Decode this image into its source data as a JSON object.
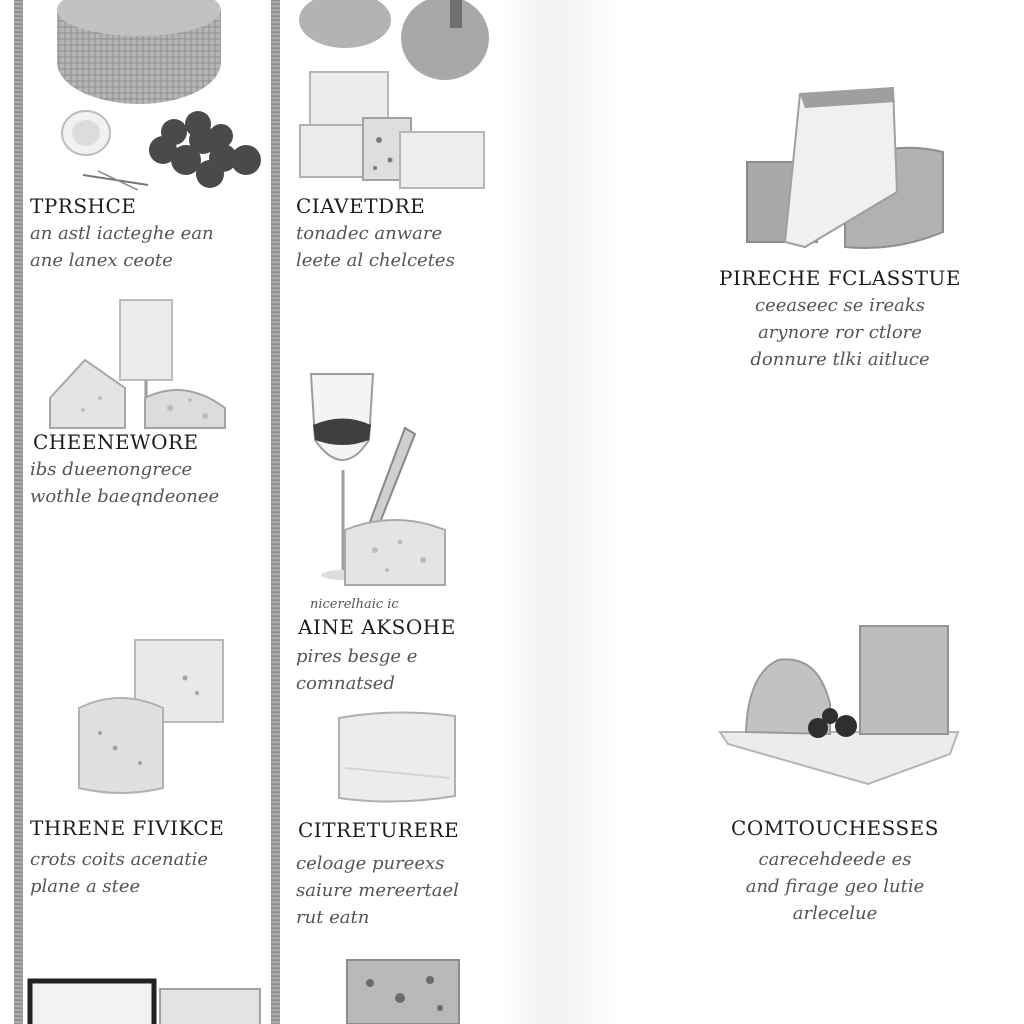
{
  "cards": [
    {
      "title": "TPRSHCE",
      "lines": [
        "an astl iacteghe ean",
        "ane lanex ceote"
      ]
    },
    {
      "title": "CIAVETDRE",
      "lines": [
        "tonadec anware",
        "leete al chelcetes"
      ]
    },
    {
      "title": "CHEENEWORE",
      "lines": [
        "ibs dueenongrece",
        "wothle baeqndeonee"
      ]
    },
    {
      "title": "AINE AKSOHE",
      "caption": "nicerelhaic ic",
      "lines": [
        "pires besge e",
        "comnatsed"
      ]
    },
    {
      "title": "THRENE FIVIKCE",
      "lines": [
        "crots coits acenatie",
        "plane a stee"
      ]
    },
    {
      "title": "CITRETURERE",
      "lines": [
        "celoage pureexs",
        "saiure mereertael",
        "rut eatn"
      ]
    },
    {
      "title": "PIRECHE FCLASSTUE",
      "lines": [
        "ceeaseec se ireaks",
        "arynore ror ctlore",
        "donnure tlki aitluce"
      ]
    },
    {
      "title": "COMTOUCHESSES",
      "lines": [
        "carecehdeede es",
        "and firage geo lutie",
        "arlecelue"
      ]
    }
  ],
  "colors": {
    "rail": "#8a8a8a",
    "title": "#1d1d1d",
    "text": "#555555",
    "cheese": "#e8e8e8",
    "rind": "#9a9a9a",
    "grape": "#4a4a4a"
  }
}
